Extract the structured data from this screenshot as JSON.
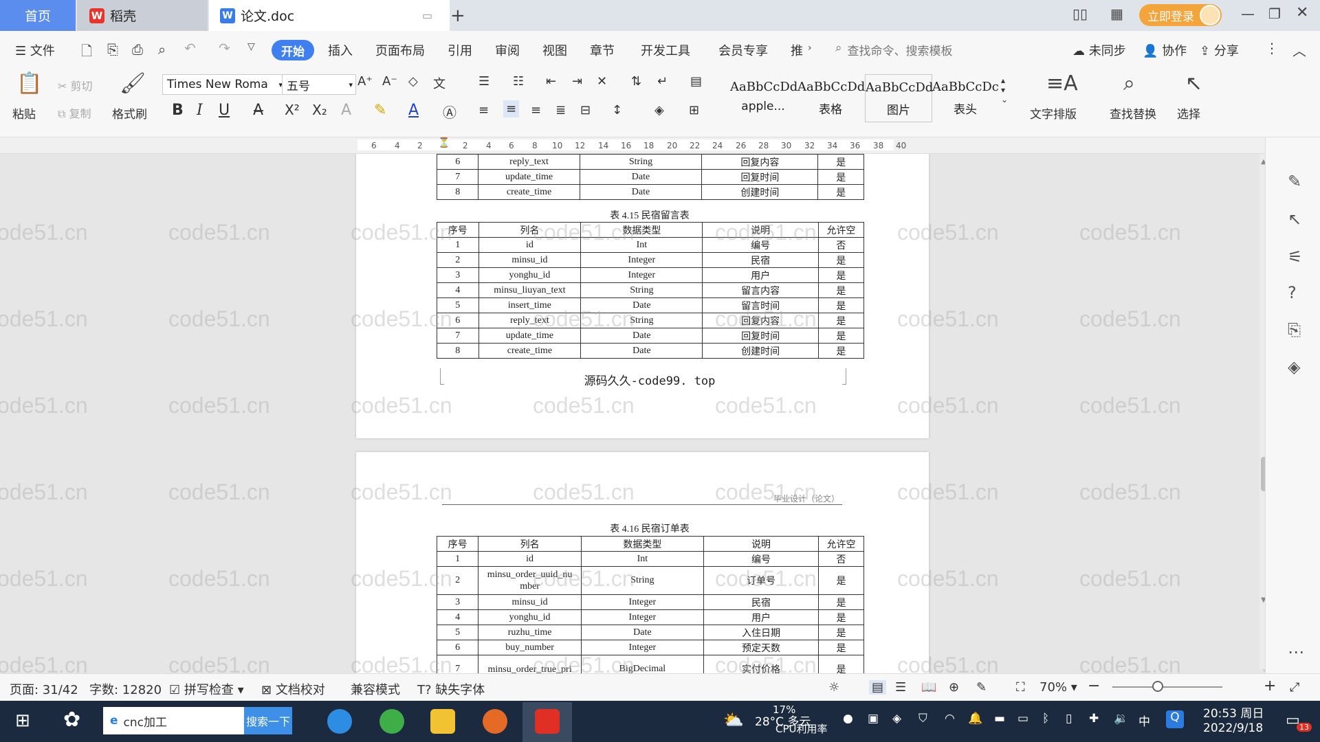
{
  "titlebar": {
    "tabs": [
      {
        "label": "首页"
      },
      {
        "label": "稻壳"
      },
      {
        "label": "论文.doc"
      }
    ],
    "login_label": "立即登录"
  },
  "menu": {
    "file": "文件",
    "items": [
      "开始",
      "插入",
      "页面布局",
      "引用",
      "审阅",
      "视图",
      "章节",
      "开发工具",
      "会员专享",
      "推"
    ],
    "search_placeholder": "查找命令、搜索模板",
    "right": [
      "未同步",
      "协作",
      "分享"
    ]
  },
  "ribbon": {
    "paste": "粘贴",
    "cut": "剪切",
    "copy": "复制",
    "format_painter": "格式刷",
    "font_name": "Times New Roma",
    "font_size": "五号",
    "styles": [
      {
        "sample": "AaBbCcDd",
        "label": "apple..."
      },
      {
        "sample": "AaBbCcDd",
        "label": "表格"
      },
      {
        "sample": "AaBbCcDd",
        "label": "图片"
      },
      {
        "sample": "AaBbCcDc",
        "label": "表头"
      }
    ],
    "text_layout": "文字排版",
    "find_replace": "查找替换",
    "select": "选择"
  },
  "ruler": [
    "6",
    "4",
    "2",
    "2",
    "4",
    "6",
    "8",
    "10",
    "12",
    "14",
    "16",
    "18",
    "20",
    "22",
    "24",
    "26",
    "28",
    "30",
    "32",
    "34",
    "36",
    "38",
    "40"
  ],
  "document": {
    "table_top_rows": [
      [
        "6",
        "reply_text",
        "String",
        "回复内容",
        "是"
      ],
      [
        "7",
        "update_time",
        "Date",
        "回复时间",
        "是"
      ],
      [
        "8",
        "create_time",
        "Date",
        "创建时间",
        "是"
      ]
    ],
    "table15_caption": "表 4.15 民宿留言表",
    "table_header": [
      "序号",
      "列名",
      "数据类型",
      "说明",
      "允许空"
    ],
    "table15_rows": [
      [
        "1",
        "id",
        "Int",
        "编号",
        "否"
      ],
      [
        "2",
        "minsu_id",
        "Integer",
        "民宿",
        "是"
      ],
      [
        "3",
        "yonghu_id",
        "Integer",
        "用户",
        "是"
      ],
      [
        "4",
        "minsu_liuyan_text",
        "String",
        "留言内容",
        "是"
      ],
      [
        "5",
        "insert_time",
        "Date",
        "留言时间",
        "是"
      ],
      [
        "6",
        "reply_text",
        "String",
        "回复内容",
        "是"
      ],
      [
        "7",
        "update_time",
        "Date",
        "回复时间",
        "是"
      ],
      [
        "8",
        "create_time",
        "Date",
        "创建时间",
        "是"
      ]
    ],
    "footer_text": "源码久久-code99. top",
    "page2_header": "毕业设计（论文）",
    "table16_caption": "表 4.16 民宿订单表",
    "table16_rows": [
      [
        "1",
        "id",
        "Int",
        "编号",
        "否"
      ],
      [
        "2",
        "minsu_order_uuid_nu mber",
        "String",
        "订单号",
        "是"
      ],
      [
        "3",
        "minsu_id",
        "Integer",
        "民宿",
        "是"
      ],
      [
        "4",
        "yonghu_id",
        "Integer",
        "用户",
        "是"
      ],
      [
        "5",
        "ruzhu_time",
        "Date",
        "入住日期",
        "是"
      ],
      [
        "6",
        "buy_number",
        "Integer",
        "预定天数",
        "是"
      ],
      [
        "7",
        "minsu_order_true_pri",
        "BigDecimal",
        "实付价格",
        "是"
      ]
    ],
    "watermark": "code51.cn"
  },
  "status": {
    "page": "页面: 31/42",
    "words": "字数: 12820",
    "spell": "拼写检查",
    "proof": "文档校对",
    "compat": "兼容模式",
    "missing_font": "缺失字体",
    "zoom": "70%"
  },
  "taskbar": {
    "search_text": "cnc加工",
    "search_btn": "搜索一下",
    "weather": "28°C 多云",
    "cpu": "17%",
    "cpu_label": "CPU利用率",
    "ime": "中",
    "time": "20:53 周日",
    "date": "2022/9/18",
    "notify_count": "13"
  }
}
